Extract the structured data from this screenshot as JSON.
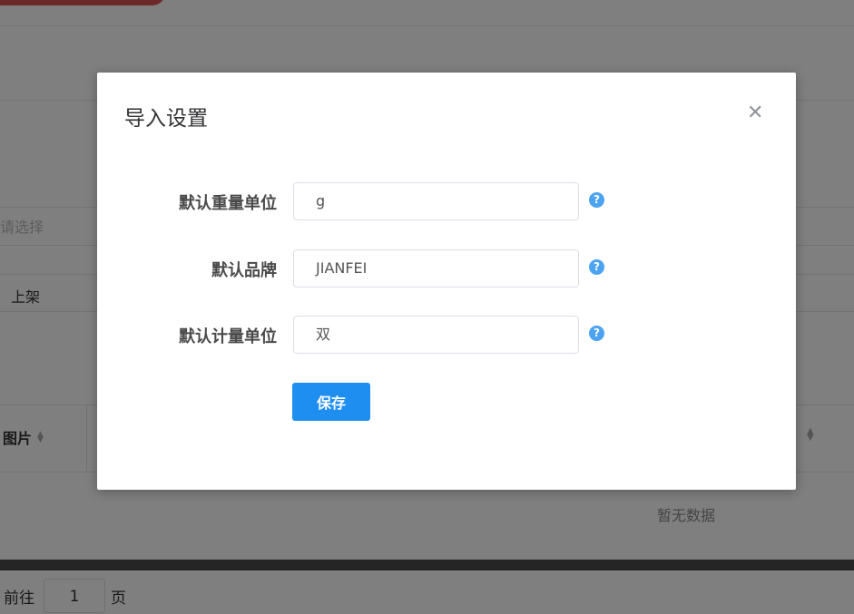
{
  "background": {
    "select_placeholder": "请选择",
    "status_value": "上架",
    "table_header_image": "图片",
    "empty_text": "暂无数据",
    "pager": {
      "goto_label": "前往",
      "page_value": "1",
      "page_unit": "页"
    }
  },
  "modal": {
    "title": "导入设置",
    "close_icon": "close-icon",
    "fields": [
      {
        "label": "默认重量单位",
        "value": "g"
      },
      {
        "label": "默认品牌",
        "value": "JIANFEI"
      },
      {
        "label": "默认计量单位",
        "value": "双"
      }
    ],
    "help_icon_glyph": "?",
    "save_label": "保存"
  },
  "colors": {
    "primary": "#1f8ef1",
    "help": "#4ca3f2",
    "overlay": "rgba(0,0,0,0.5)",
    "accent_red": "#d9534f"
  }
}
